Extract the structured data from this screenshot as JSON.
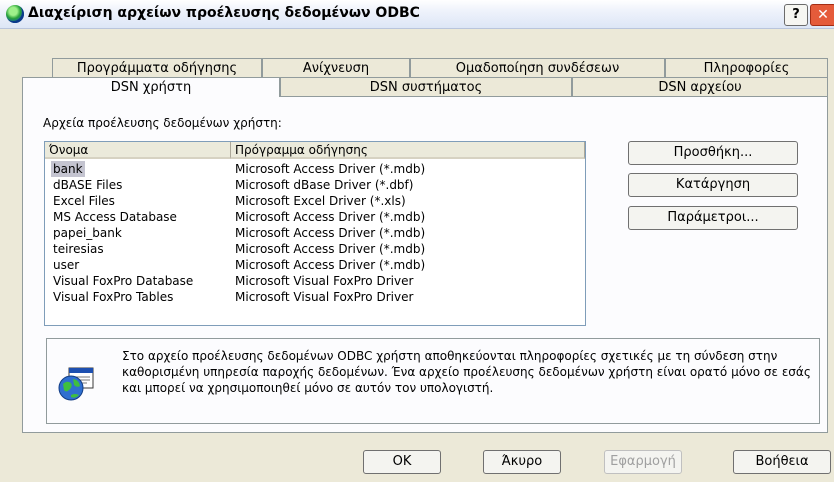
{
  "window": {
    "title": "Διαχείριση αρχείων προέλευσης δεδομένων ODBC",
    "help_label": "?",
    "close_label": "✕"
  },
  "tabs_back": [
    {
      "label": "Προγράμματα οδήγησης"
    },
    {
      "label": "Ανίχνευση"
    },
    {
      "label": "Ομαδοποίηση συνδέσεων"
    },
    {
      "label": "Πληροφορίες"
    }
  ],
  "tabs_front": [
    {
      "label": "DSN χρήστη",
      "active": true
    },
    {
      "label": "DSN συστήματος",
      "active": false
    },
    {
      "label": "DSN αρχείου",
      "active": false
    }
  ],
  "section_label": "Αρχεία προέλευσης δεδομένων χρήστη:",
  "list": {
    "columns": [
      "Όνομα",
      "Πρόγραμμα οδήγησης"
    ],
    "rows": [
      {
        "name": "bank",
        "driver": "Microsoft Access Driver (*.mdb)",
        "selected": true
      },
      {
        "name": "dBASE Files",
        "driver": "Microsoft dBase Driver (*.dbf)"
      },
      {
        "name": "Excel Files",
        "driver": "Microsoft Excel Driver (*.xls)"
      },
      {
        "name": "MS Access Database",
        "driver": "Microsoft Access Driver (*.mdb)"
      },
      {
        "name": "papei_bank",
        "driver": "Microsoft Access Driver (*.mdb)"
      },
      {
        "name": "teiresias",
        "driver": "Microsoft Access Driver (*.mdb)"
      },
      {
        "name": "user",
        "driver": "Microsoft Access Driver (*.mdb)"
      },
      {
        "name": "Visual FoxPro Database",
        "driver": "Microsoft Visual FoxPro Driver"
      },
      {
        "name": "Visual FoxPro Tables",
        "driver": "Microsoft Visual FoxPro Driver"
      }
    ]
  },
  "side_buttons": {
    "add": "Προσθήκη...",
    "remove": "Κατάργηση",
    "configure": "Παράμετροι..."
  },
  "info": {
    "icon": "odbc-datasource-icon",
    "text": "Στο αρχείο προέλευσης δεδομένων ODBC χρήστη αποθηκεύονται πληροφορίες σχετικές με τη σύνδεση στην καθορισμένη υπηρεσία παροχής δεδομένων. Ένα αρχείο προέλευσης δεδομένων χρήστη είναι ορατό μόνο σε εσάς και μπορεί να χρησιμοποιηθεί μόνο σε αυτόν τον υπολογιστή."
  },
  "buttons": {
    "ok": "OK",
    "cancel": "Άκυρο",
    "apply": "Εφαρμογή",
    "help": "Βοήθεια"
  }
}
